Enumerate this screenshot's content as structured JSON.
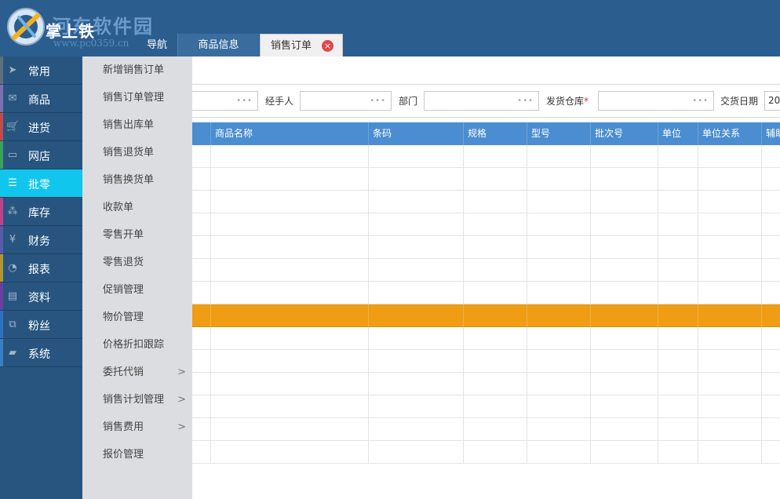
{
  "header": {
    "brand": "掌上铁",
    "watermark_title": "河东软件园",
    "watermark_url": "www.pc0359.cn"
  },
  "tabs": [
    {
      "label": "导航"
    },
    {
      "label": "商品信息"
    },
    {
      "label": "销售订单",
      "close": "×"
    }
  ],
  "sidebar": {
    "items": [
      {
        "label": "常用",
        "icon": "send-icon",
        "glyph": "➤",
        "stripe": "#5f6f7d"
      },
      {
        "label": "商品",
        "icon": "mail-icon",
        "glyph": "✉",
        "stripe": "#7e6fb0"
      },
      {
        "label": "进货",
        "icon": "cart-icon",
        "glyph": "🛒",
        "stripe": "#c44a4a"
      },
      {
        "label": "网店",
        "icon": "monitor-icon",
        "glyph": "▭",
        "stripe": "#3aa35a"
      },
      {
        "label": "批零",
        "icon": "list-icon",
        "glyph": "☰",
        "stripe": "#11c6ec"
      },
      {
        "label": "库存",
        "icon": "boxes-icon",
        "glyph": "⁂",
        "stripe": "#c0408a"
      },
      {
        "label": "财务",
        "icon": "yen-icon",
        "glyph": "¥",
        "stripe": "#5a5aa8"
      },
      {
        "label": "报表",
        "icon": "pie-chart-icon",
        "glyph": "◔",
        "stripe": "#b5962e"
      },
      {
        "label": "资料",
        "icon": "document-icon",
        "glyph": "▤",
        "stripe": "#6b3fa0"
      },
      {
        "label": "粉丝",
        "icon": "hierarchy-icon",
        "glyph": "⧉",
        "stripe": "#2f6fbf"
      },
      {
        "label": "系统",
        "icon": "truck-icon",
        "glyph": "▰",
        "stripe": "#3a7fbf"
      }
    ]
  },
  "submenu": {
    "items": [
      {
        "label": "新增销售订单",
        "arrow": ""
      },
      {
        "label": "销售订单管理",
        "arrow": ""
      },
      {
        "label": "销售出库单",
        "arrow": ""
      },
      {
        "label": "销售退货单",
        "arrow": ""
      },
      {
        "label": "销售换货单",
        "arrow": ""
      },
      {
        "label": "收款单",
        "arrow": ""
      },
      {
        "label": "零售开单",
        "arrow": ""
      },
      {
        "label": "零售退货",
        "arrow": ""
      },
      {
        "label": "促销管理",
        "arrow": ""
      },
      {
        "label": "物价管理",
        "arrow": ""
      },
      {
        "label": "价格折扣跟踪",
        "arrow": ""
      },
      {
        "label": "委托代销",
        "arrow": ">"
      },
      {
        "label": "销售计划管理",
        "arrow": ">"
      },
      {
        "label": "销售费用",
        "arrow": ">"
      },
      {
        "label": "报价管理",
        "arrow": ""
      }
    ]
  },
  "filters": {
    "handler_label": "经手人",
    "dept_label": "部门",
    "warehouse_label": "发货仓库",
    "required_mark": "*",
    "delivery_date_label": "交货日期",
    "delivery_date_value": "20",
    "lookup_dots": "•••"
  },
  "grid": {
    "columns": [
      "",
      "商品名称",
      "条码",
      "规格",
      "型号",
      "批次号",
      "单位",
      "单位关系",
      "辅助"
    ],
    "row_count": 14,
    "highlight_row": 7
  },
  "colors": {
    "header_bg": "#2c5d8f",
    "sidebar_bg": "#27557f",
    "sidebar_active": "#11c6ec",
    "grid_header": "#4a8dd0",
    "row_highlight": "#ee9d14",
    "close_icon": "#e0474c"
  }
}
